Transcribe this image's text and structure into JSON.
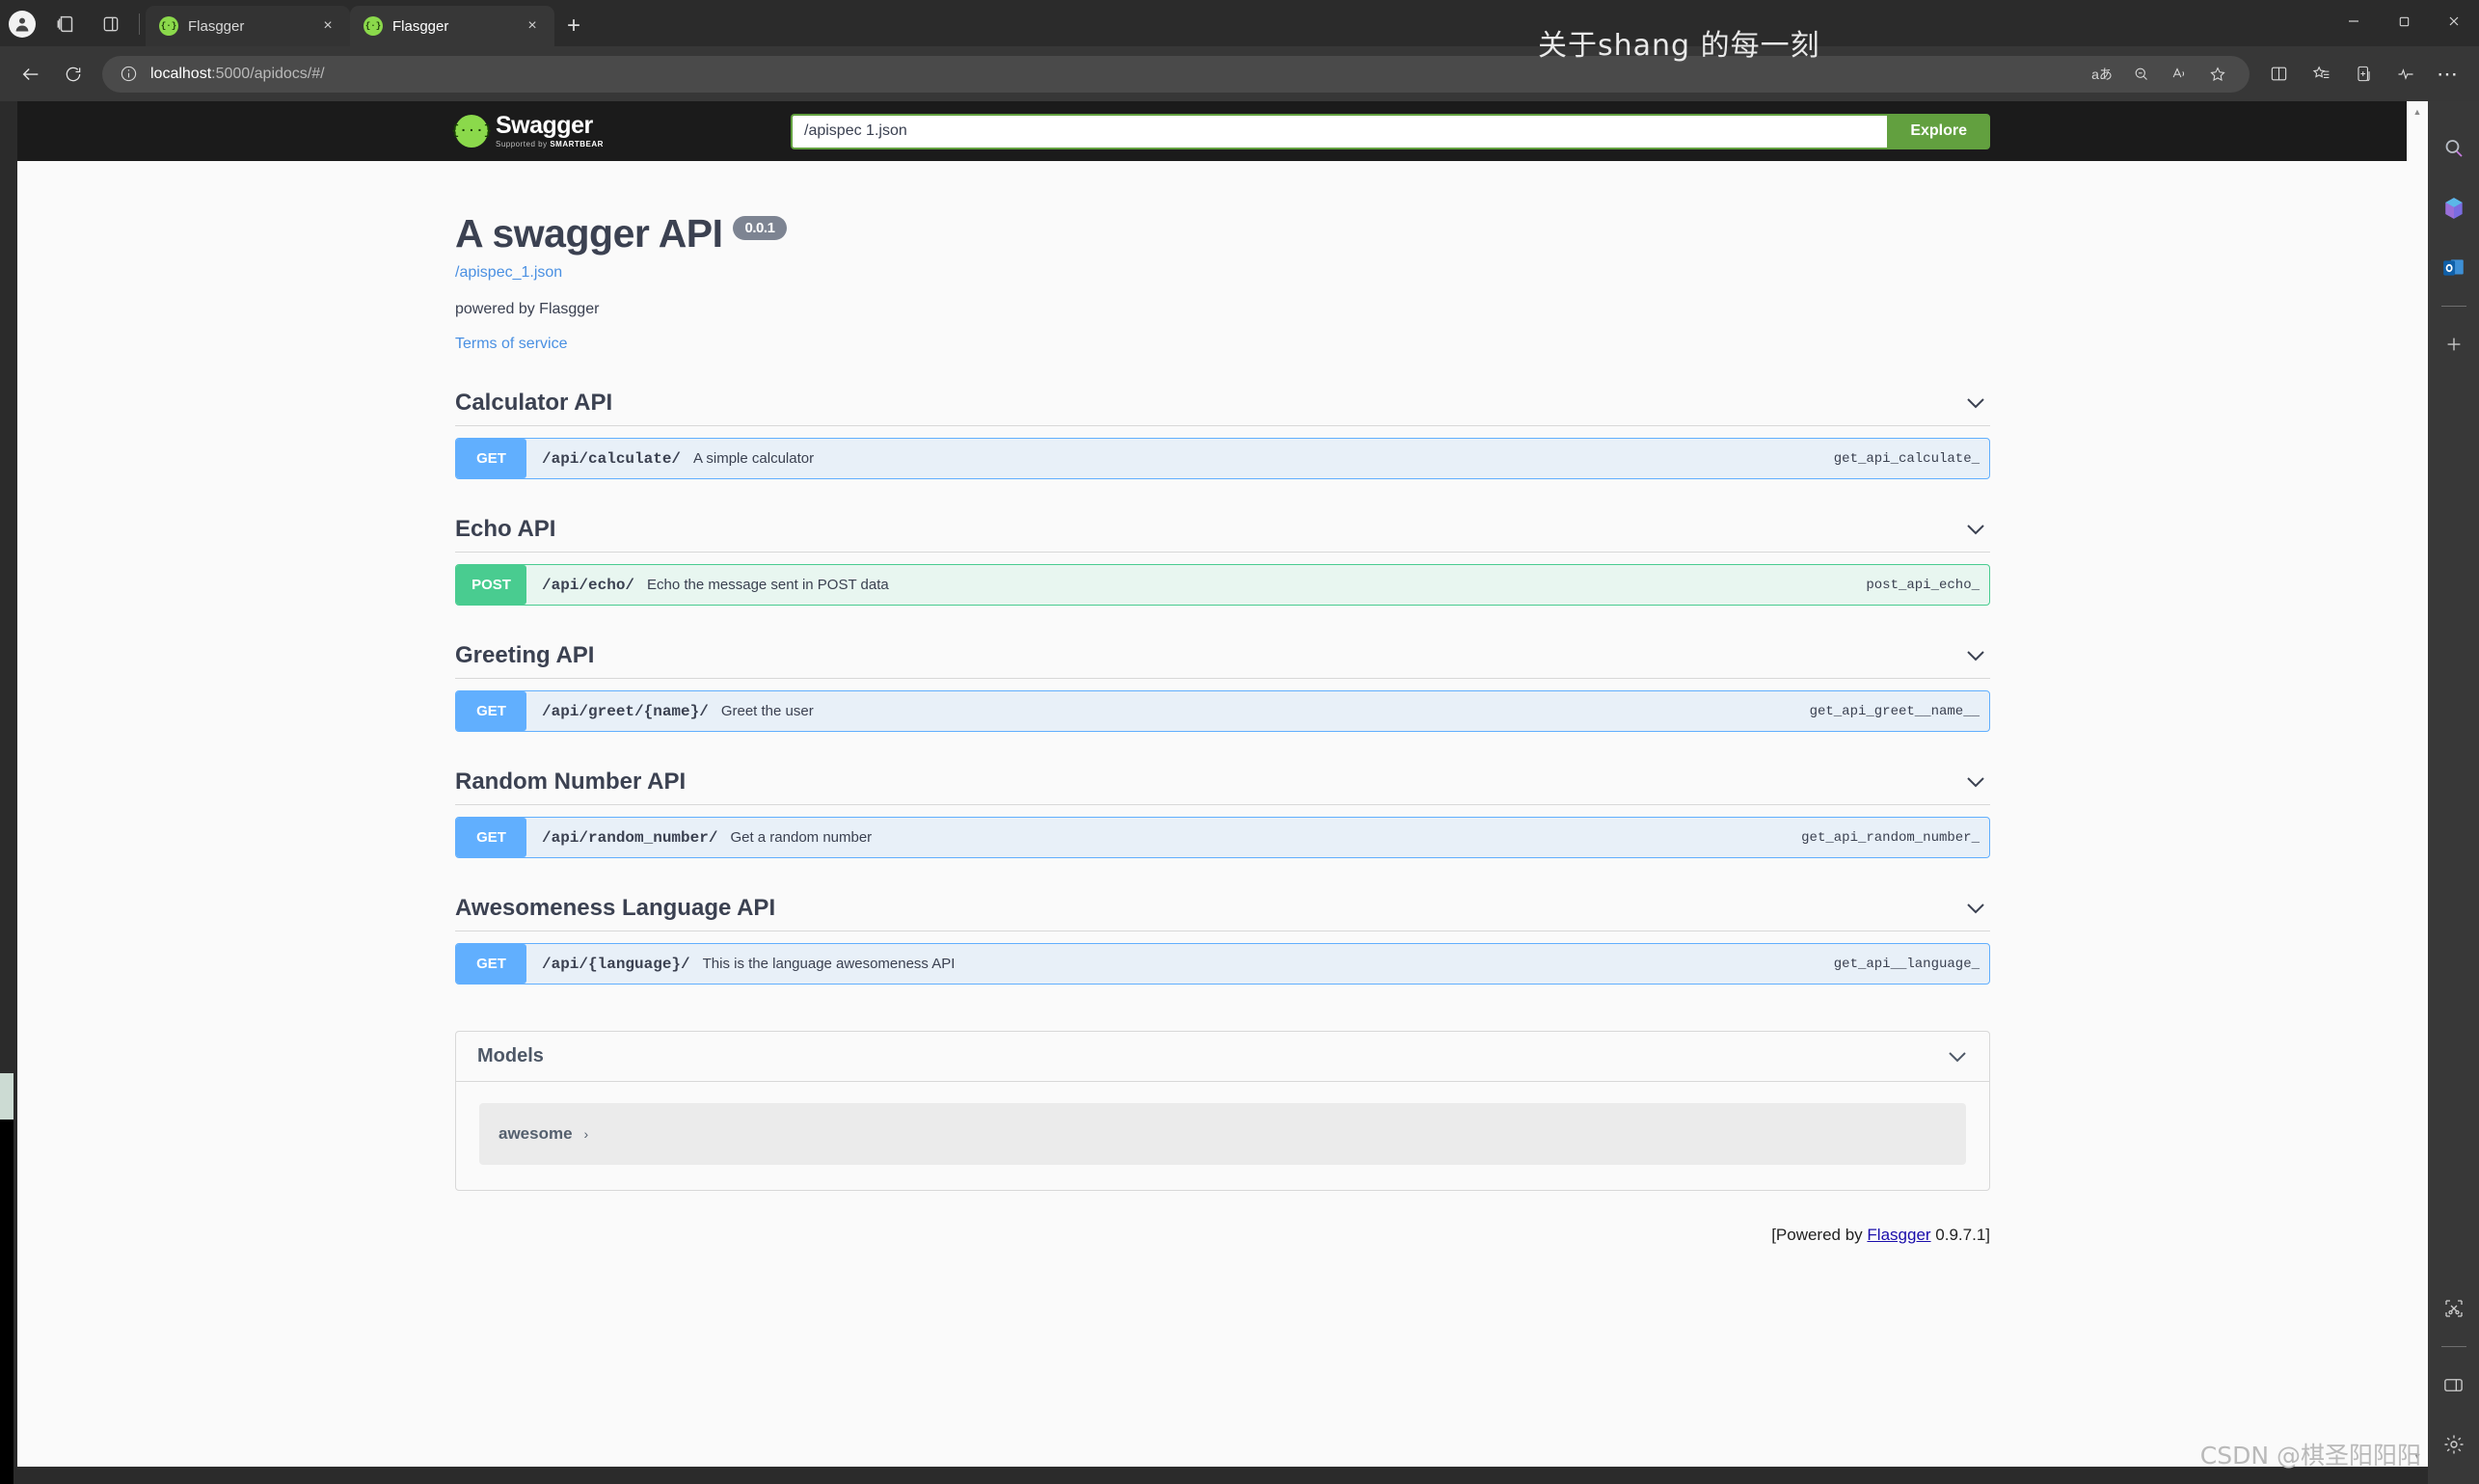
{
  "browser": {
    "profile_icon": "profile-avatar-icon",
    "collections_icon": "collections-icon",
    "split_pane_icon": "split-pane-icon",
    "tabs": [
      {
        "title": "Flasgger",
        "favicon": "swagger-favicon",
        "close": "×",
        "active": false
      },
      {
        "title": "Flasgger",
        "favicon": "swagger-favicon",
        "close": "×",
        "active": true
      }
    ],
    "new_tab_label": "+",
    "window_controls": {
      "minimize": "—",
      "maximize": "⎕",
      "close": "✕"
    },
    "nav": {
      "back": "←",
      "reload": "↻"
    },
    "omnibox": {
      "info_icon": "info-circle-icon",
      "url_host": "localhost",
      "url_rest": ":5000/apidocs/#/",
      "actions": [
        "translate-icon",
        "zoom-icon",
        "read-aloud-icon",
        "favorite-star-icon"
      ]
    },
    "toolbar_actions": [
      "split-screen-icon",
      "favorites-icon",
      "collections-icon",
      "browser-essentials-icon",
      "settings-more-icon"
    ],
    "watermark_top": "关于shang 的每一刻",
    "watermark_bottom": "CSDN @棋圣阳阳阳",
    "right_rail": {
      "top_icons": [
        "search-icon",
        "microsoft365-icon",
        "outlook-icon"
      ],
      "add_label": "+",
      "bottom_icons": [
        "screenshot-snip-icon",
        "split-screen-icon",
        "settings-gear-icon"
      ]
    },
    "scrollbar": {
      "up": "▲",
      "down": "▼"
    }
  },
  "swagger": {
    "logo": {
      "mark": "{···}",
      "name": "Swagger",
      "supported_prefix": "Supported by ",
      "supported_brand": "SMARTBEAR"
    },
    "spec_input_value": "/apispec 1.json",
    "spec_input_placeholder": "/apispec_1.json",
    "explore_label": "Explore",
    "info": {
      "title": "A swagger API",
      "version": "0.0.1",
      "spec_link": "/apispec_1.json",
      "description": "powered by Flasgger",
      "terms_label": "Terms of service"
    },
    "chevron": "⌄",
    "tags": [
      {
        "name": "Calculator API",
        "operations": [
          {
            "verb": "GET",
            "method": "get",
            "path": "/api/calculate/",
            "summary": "A simple calculator",
            "operation_id": "get_api_calculate_"
          }
        ]
      },
      {
        "name": "Echo API",
        "operations": [
          {
            "verb": "POST",
            "method": "post",
            "path": "/api/echo/",
            "summary": "Echo the message sent in POST data",
            "operation_id": "post_api_echo_"
          }
        ]
      },
      {
        "name": "Greeting API",
        "operations": [
          {
            "verb": "GET",
            "method": "get",
            "path": "/api/greet/{name}/",
            "summary": "Greet the user",
            "operation_id": "get_api_greet__name__"
          }
        ]
      },
      {
        "name": "Random Number API",
        "operations": [
          {
            "verb": "GET",
            "method": "get",
            "path": "/api/random_number/",
            "summary": "Get a random number",
            "operation_id": "get_api_random_number_"
          }
        ]
      },
      {
        "name": "Awesomeness Language API",
        "operations": [
          {
            "verb": "GET",
            "method": "get",
            "path": "/api/{language}/",
            "summary": "This is the language awesomeness API",
            "operation_id": "get_api__language_"
          }
        ]
      }
    ],
    "models": {
      "title": "Models",
      "items": [
        {
          "name": "awesome",
          "arrow": "›"
        }
      ]
    },
    "footer": {
      "prefix": "[Powered by ",
      "link": "Flasgger",
      "suffix": " 0.9.7.1]"
    }
  },
  "colors": {
    "swagger_green": "#62a03f",
    "get_blue": "#61affe",
    "post_green": "#49cc90",
    "link_blue": "#4a90e2",
    "text_dark": "#3b4151"
  }
}
